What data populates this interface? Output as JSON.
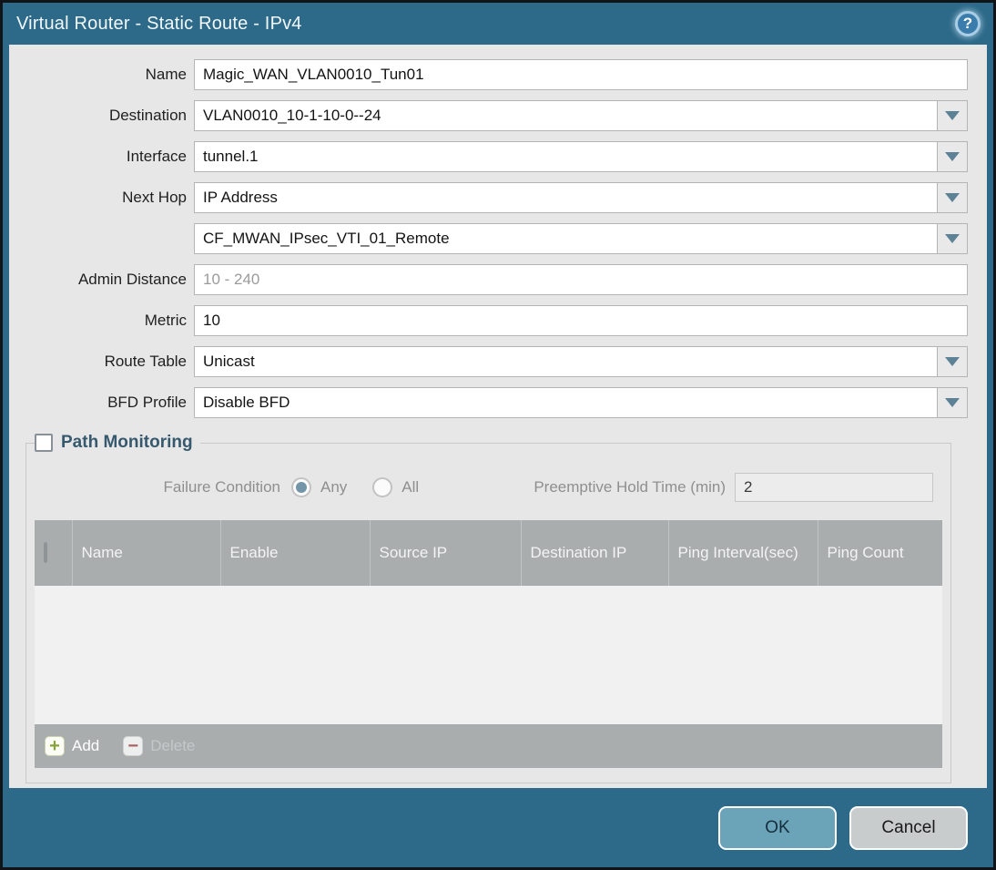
{
  "dialog": {
    "title": "Virtual Router - Static Route - IPv4",
    "help_icon_glyph": "?"
  },
  "form": {
    "fields": [
      {
        "label": "Name",
        "value": "Magic_WAN_VLAN0010_Tun01",
        "type": "text"
      },
      {
        "label": "Destination",
        "value": "VLAN0010_10-1-10-0--24",
        "type": "dropdown"
      },
      {
        "label": "Interface",
        "value": "tunnel.1",
        "type": "dropdown"
      },
      {
        "label": "Next Hop",
        "value": "IP Address",
        "type": "dropdown"
      },
      {
        "label": "",
        "value": "CF_MWAN_IPsec_VTI_01_Remote",
        "type": "dropdown"
      },
      {
        "label": "Admin Distance",
        "value": "",
        "placeholder": "10 - 240",
        "type": "text"
      },
      {
        "label": "Metric",
        "value": "10",
        "type": "text"
      },
      {
        "label": "Route Table",
        "value": "Unicast",
        "type": "dropdown"
      },
      {
        "label": "BFD Profile",
        "value": "Disable BFD",
        "type": "dropdown"
      }
    ]
  },
  "path_monitoring": {
    "legend": "Path Monitoring",
    "checked": false,
    "failure_condition_label": "Failure Condition",
    "options": [
      {
        "label": "Any",
        "selected": true
      },
      {
        "label": "All",
        "selected": false
      }
    ],
    "preemptive_label": "Preemptive Hold Time (min)",
    "preemptive_value": "2",
    "table": {
      "columns": [
        "Name",
        "Enable",
        "Source IP",
        "Destination IP",
        "Ping Interval(sec)",
        "Ping Count"
      ],
      "rows": []
    },
    "add_label": "Add",
    "delete_label": "Delete"
  },
  "footer": {
    "ok_label": "OK",
    "cancel_label": "Cancel"
  },
  "colors": {
    "titlebar_teal": "#2d6a89",
    "body_gray": "#e7e7e7",
    "table_header_gray": "#a9adae",
    "ok_button_teal": "#6ba3b8",
    "cancel_button_gray": "#c9cccd",
    "legend_text": "#36596e",
    "radio_selected_dot": "#7296a8",
    "add_plus_green": "#87a33a",
    "delete_minus_red": "#a86060",
    "dropdown_arrow": "#5d8296"
  }
}
